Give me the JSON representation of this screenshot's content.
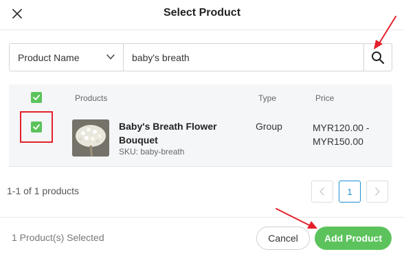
{
  "dialog": {
    "title": "Select Product"
  },
  "search": {
    "field_selected": "Product Name",
    "query": "baby's breath"
  },
  "table": {
    "columns": [
      "Products",
      "Type",
      "Price"
    ],
    "rows": [
      {
        "name": "Baby's Breath Flower Bouquet",
        "sku": "SKU: baby-breath",
        "type": "Group",
        "price": "MYR120.00 - MYR150.00",
        "checked": true
      }
    ]
  },
  "pagination": {
    "summary": "1-1 of 1 products",
    "current_page": "1",
    "prev": "<",
    "next": ">"
  },
  "footer": {
    "selected_text": "1 Product(s) Selected",
    "cancel_label": "Cancel",
    "add_label": "Add Product"
  },
  "colors": {
    "accent_green": "#5cc35c",
    "annotation_red": "#e3202a",
    "page_active_blue": "#1a8fd0"
  },
  "icons": [
    "close-icon",
    "chevron-down-icon",
    "search-icon",
    "check-icon",
    "chevron-left-icon",
    "chevron-right-icon"
  ]
}
